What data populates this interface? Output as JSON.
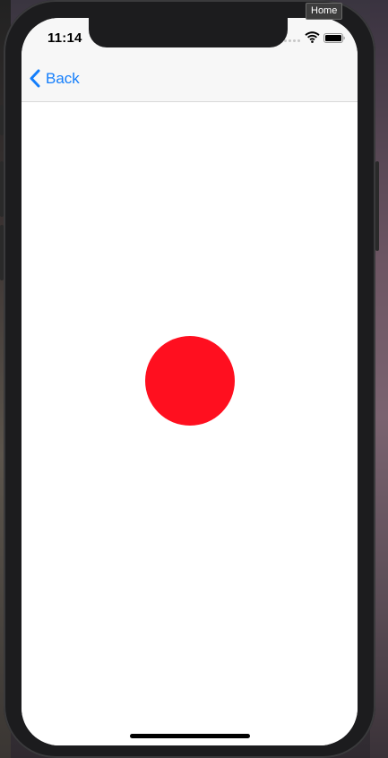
{
  "window": {
    "tooltip": "Home"
  },
  "status_bar": {
    "time": "11:14",
    "icons": [
      "signal-icon",
      "wifi-icon",
      "battery-icon"
    ]
  },
  "nav_bar": {
    "back_label": "Back",
    "back_icon": "chevron-left-icon"
  },
  "content": {
    "shape": "circle",
    "shape_color": "#ff0f1f"
  },
  "colors": {
    "accent": "#147efb",
    "nav_background": "#f7f7f7",
    "screen_background": "#ffffff"
  }
}
